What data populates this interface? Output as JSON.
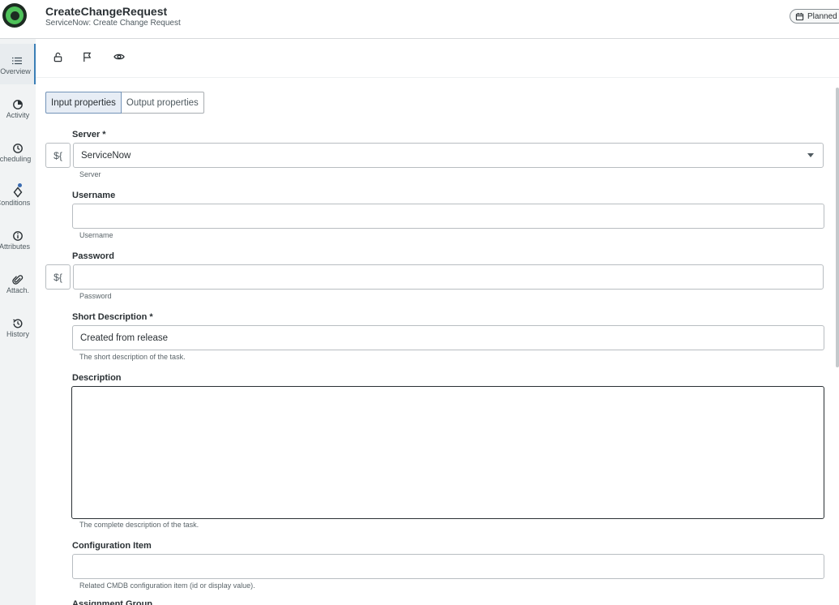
{
  "header": {
    "title": "CreateChangeRequest",
    "subtitle": "ServiceNow: Create Change Request",
    "status_badge": "Planned"
  },
  "sidebar": {
    "items": [
      {
        "label": "Overview",
        "icon": "list-icon",
        "active": true
      },
      {
        "label": "Activity",
        "icon": "activity-icon"
      },
      {
        "label": "Scheduling",
        "icon": "clock-icon"
      },
      {
        "label": "Conditions",
        "icon": "diamond-icon",
        "has_dot": true
      },
      {
        "label": "Attributes",
        "icon": "info-icon"
      },
      {
        "label": "Attach.",
        "icon": "paperclip-icon"
      },
      {
        "label": "History",
        "icon": "history-icon"
      }
    ]
  },
  "toolbar": {
    "icons": [
      "unlock-icon",
      "flag-icon",
      "eye-icon"
    ]
  },
  "tabs": {
    "input": "Input properties",
    "output": "Output properties",
    "active": "input"
  },
  "form": {
    "server": {
      "label": "Server *",
      "value": "ServiceNow",
      "helper": "Server"
    },
    "username": {
      "label": "Username",
      "value": "",
      "helper": "Username"
    },
    "password": {
      "label": "Password",
      "value": "",
      "helper": "Password"
    },
    "short_description": {
      "label": "Short Description *",
      "value": "Created from release",
      "helper": "The short description of the task."
    },
    "description": {
      "label": "Description",
      "value": "",
      "helper": "The complete description of the task."
    },
    "configuration_item": {
      "label": "Configuration Item",
      "value": "",
      "helper": "Related CMDB configuration item (id or display value)."
    },
    "next_field_label": "Assignment Group",
    "variable_button": "${"
  },
  "colors": {
    "accent": "#3b7fb6",
    "logo_green": "#4fc25a",
    "sidebar_bg": "#f1f3f4"
  }
}
